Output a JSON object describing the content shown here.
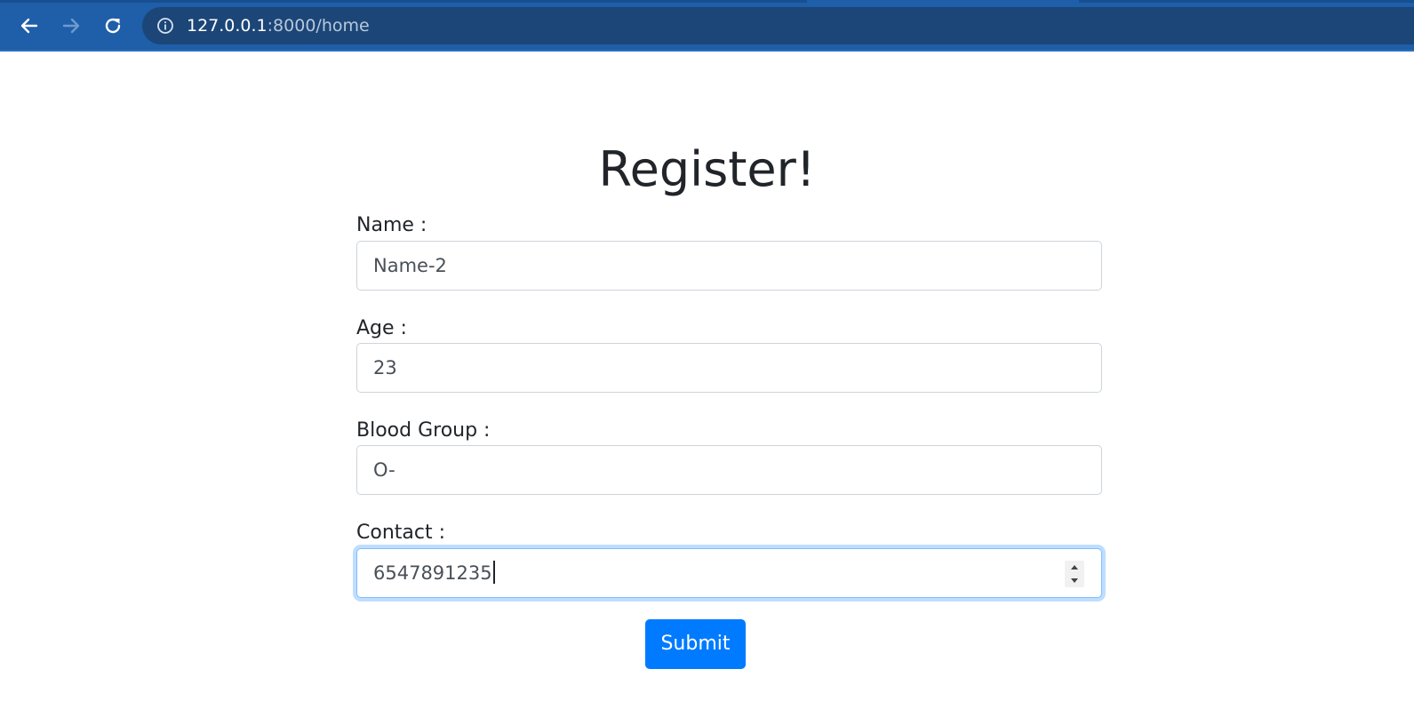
{
  "browser": {
    "url_host": "127.0.0.1",
    "url_path": ":8000/home",
    "icons": {
      "back": "back-arrow-icon",
      "forward": "forward-arrow-icon",
      "reload": "reload-icon",
      "site_info": "info-icon"
    },
    "colors": {
      "toolbar": "#1f5ea8",
      "omnibox": "#1b4677"
    }
  },
  "page": {
    "title": "Register!",
    "fields": [
      {
        "label": "Name :",
        "value": "Name-2"
      },
      {
        "label": "Age :",
        "value": "23"
      },
      {
        "label": "Blood Group :",
        "value": "O-"
      },
      {
        "label": "Contact :",
        "value": "6547891235"
      }
    ],
    "submit_label": "Submit",
    "colors": {
      "primary": "#007bff",
      "focus_border": "#80bdff",
      "text": "#212529"
    }
  }
}
